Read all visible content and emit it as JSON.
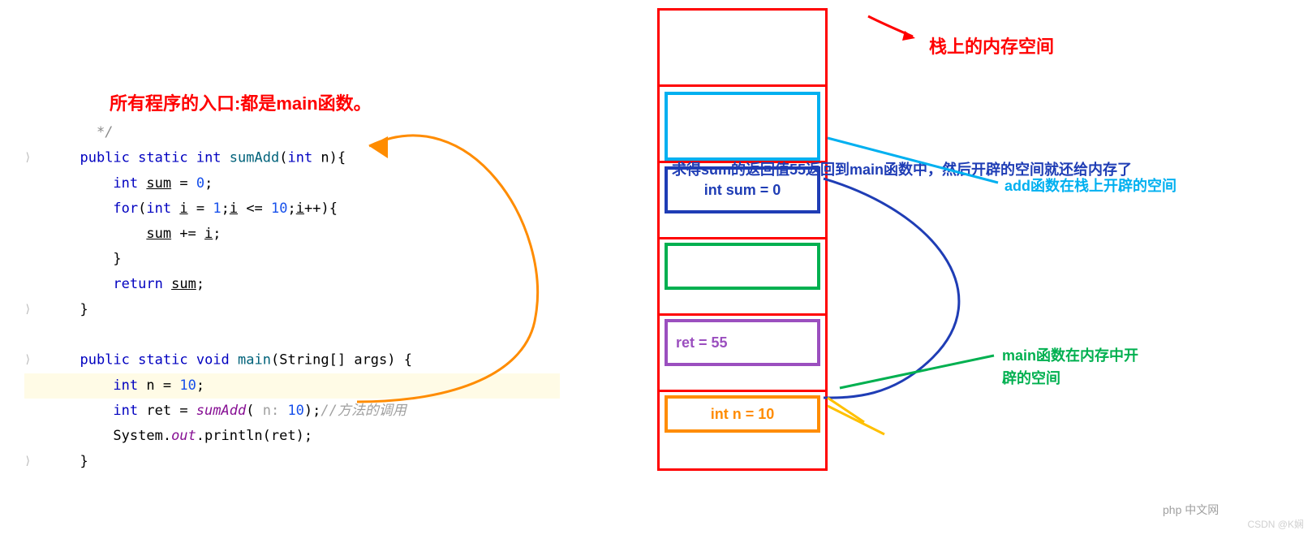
{
  "title": "所有程序的入口:都是main函数。",
  "code": {
    "close_comment": "*/",
    "line_sig": "public static int sumAdd(int n){",
    "line_sum_decl": "int sum = 0;",
    "line_for": "for(int i = 1;i <= 10;i++){",
    "line_sum_inc": "sum += i;",
    "line_brace1": "}",
    "line_return": "return sum;",
    "line_brace2": "}",
    "line_main": "public static void main(String[] args) {",
    "line_n": "int n = 10;",
    "line_ret": "int ret = sumAdd( n: 10);",
    "line_ret_comment": "//方法的调用",
    "line_print": "System.out.println(ret);",
    "line_brace3": "}"
  },
  "stack": {
    "sum_box": "int sum = 0",
    "ret_box": "ret = 55",
    "n_box": "int n = 10"
  },
  "annotations": {
    "stack_label": "栈上的内存空间",
    "sum_return": "求得sum的返回值55返回到main函数中，然后开辟的空间就还给内存了",
    "add_space": "add函数在栈上开辟的空间",
    "main_space_1": "main函数在内存中开",
    "main_space_2": "辟的空间"
  },
  "watermark": "CSDN @K娴",
  "watermark2": "php 中文网"
}
